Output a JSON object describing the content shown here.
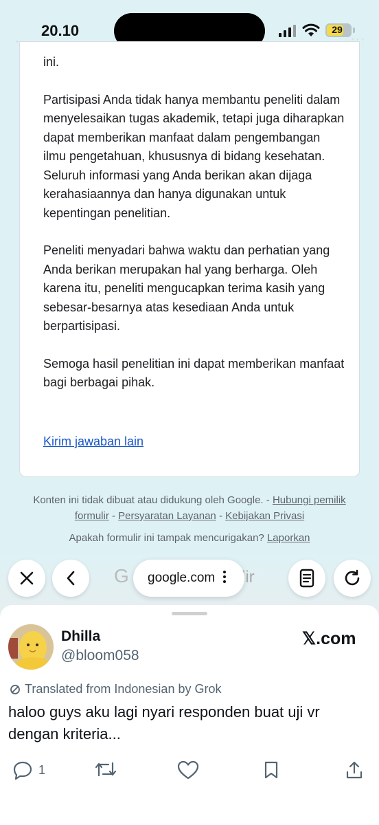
{
  "status_bar": {
    "time": "20.10",
    "battery": "29"
  },
  "form": {
    "partial_line": "ini.",
    "paragraphs": [
      "Partisipasi Anda tidak hanya membantu peneliti dalam menyelesaikan tugas akademik, tetapi juga diharapkan dapat memberikan manfaat dalam pengembangan ilmu pengetahuan, khususnya di bidang kesehatan. Seluruh informasi yang Anda berikan akan dijaga kerahasiaannya dan hanya digunakan untuk kepentingan penelitian.",
      "Peneliti menyadari bahwa waktu dan perhatian yang Anda berikan merupakan hal yang berharga. Oleh karena itu, peneliti mengucapkan terima kasih yang sebesar-besarnya atas kesediaan Anda untuk berpartisipasi.",
      "Semoga hasil penelitian ini dapat memberikan manfaat bagi berbagai pihak."
    ],
    "link": "Kirim jawaban lain"
  },
  "footer": {
    "disclaimer": "Konten ini tidak dibuat atau didukung oleh Google.",
    "sep": " - ",
    "contact": "Hubungi pemilik formulir",
    "terms": "Persyaratan Layanan",
    "privacy": "Kebijakan Privasi",
    "question": "Apakah formulir ini tampak mencurigakan?",
    "report": "Laporkan"
  },
  "browser": {
    "url": "google.com",
    "ghost_left": "G",
    "ghost_right": "lir"
  },
  "tweet": {
    "name": "Dhilla",
    "handle": "@bloom058",
    "source": "𝕏.com",
    "translated": "Translated from Indonesian by Grok",
    "text": "haloo guys aku lagi nyari responden buat uji vr dengan kriteria...",
    "reply_count": "1"
  },
  "colors": {
    "background": "#def2f6",
    "link": "#1a58c6",
    "muted": "#536471"
  },
  "icons": {
    "close": "close-icon",
    "back": "chevron-left-icon",
    "reader": "reader-icon",
    "reload": "reload-icon",
    "reply": "reply-icon",
    "retweet": "retweet-icon",
    "like": "heart-icon",
    "bookmark": "bookmark-icon",
    "share": "share-icon"
  }
}
